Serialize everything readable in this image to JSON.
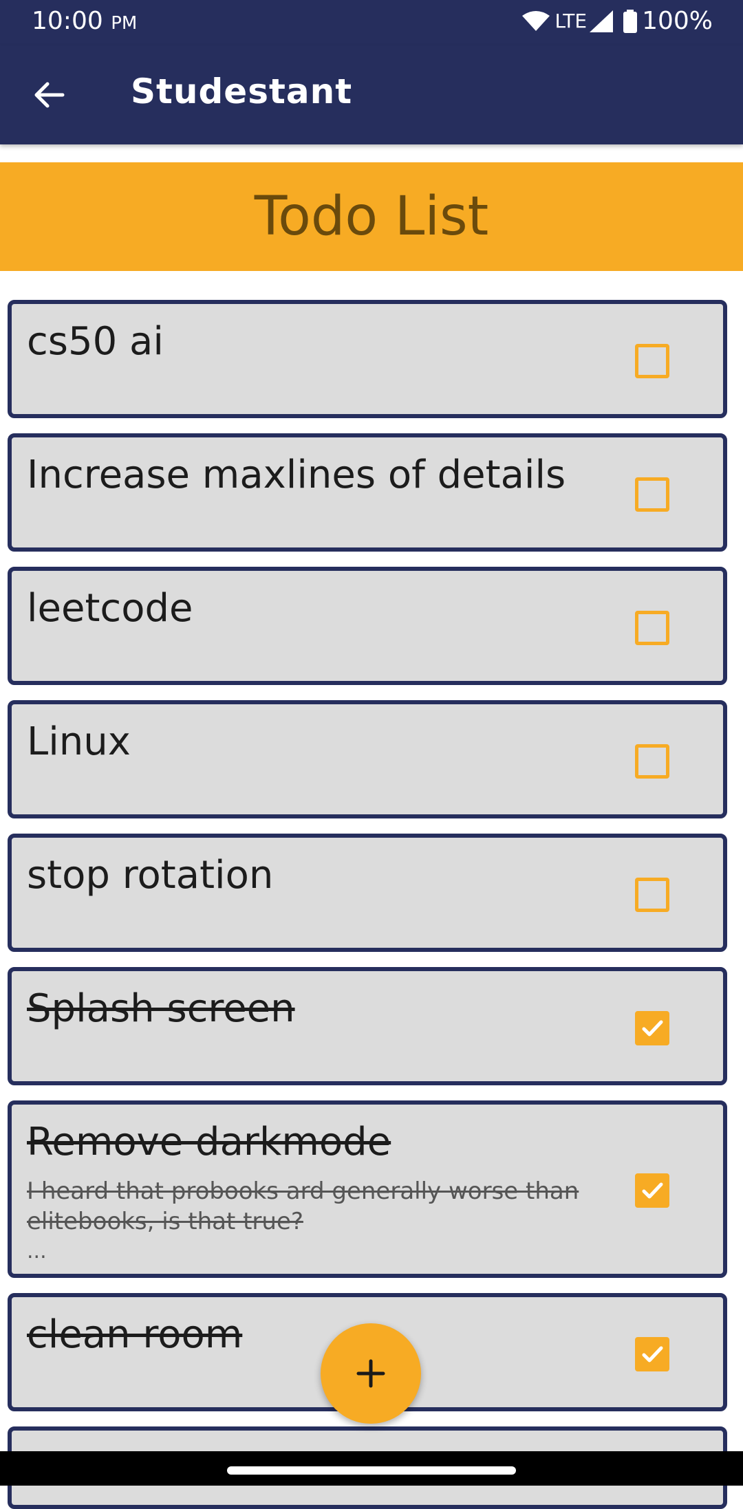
{
  "status_bar": {
    "time": "10:00",
    "ampm": "PM",
    "network": "LTE",
    "battery": "100%"
  },
  "app_bar": {
    "title": "Studestant",
    "back_icon": "arrow-left-icon"
  },
  "banner": {
    "title": "Todo List"
  },
  "todos": [
    {
      "title": "cs50 ai",
      "details": "",
      "done": false
    },
    {
      "title": "Increase maxlines of details",
      "details": "",
      "done": false
    },
    {
      "title": "leetcode",
      "details": "",
      "done": false
    },
    {
      "title": "Linux",
      "details": "",
      "done": false
    },
    {
      "title": "stop rotation",
      "details": "",
      "done": false
    },
    {
      "title": "Splash screen",
      "details": "",
      "done": true
    },
    {
      "title": "Remove darkmode",
      "details": "I heard that probooks ard generally worse than elitebooks, is that true?",
      "more": "...",
      "done": true
    },
    {
      "title": "clean room",
      "details": "",
      "done": true
    }
  ],
  "fab": {
    "icon": "plus-icon"
  },
  "colors": {
    "primary": "#262e5d",
    "accent": "#f7ab24",
    "card_bg": "#dcdcdc"
  }
}
